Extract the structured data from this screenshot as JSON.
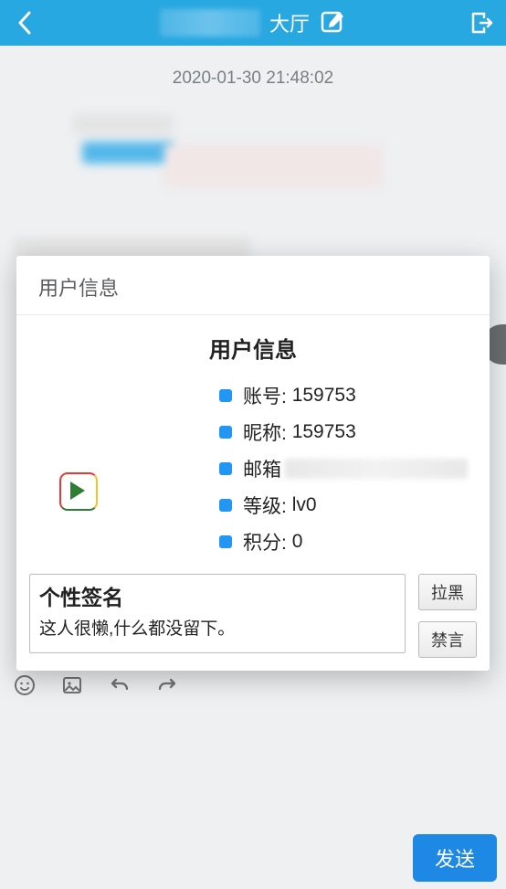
{
  "header": {
    "title_suffix": "大厅"
  },
  "chat": {
    "timestamp": "2020-01-30 21:48:02"
  },
  "modal": {
    "header": "用户信息",
    "title": "用户信息",
    "fields": {
      "account_label": "账号:",
      "account_value": "159753",
      "nickname_label": "昵称:",
      "nickname_value": "159753",
      "email_label": "邮箱",
      "level_label": "等级:",
      "level_value": "lv0",
      "points_label": "积分:",
      "points_value": "0"
    },
    "signature": {
      "title": "个性签名",
      "text": "这人很懒,什么都没留下。"
    },
    "actions": {
      "blacklist": "拉黑",
      "mute": "禁言"
    }
  },
  "compose": {
    "send": "发送"
  }
}
